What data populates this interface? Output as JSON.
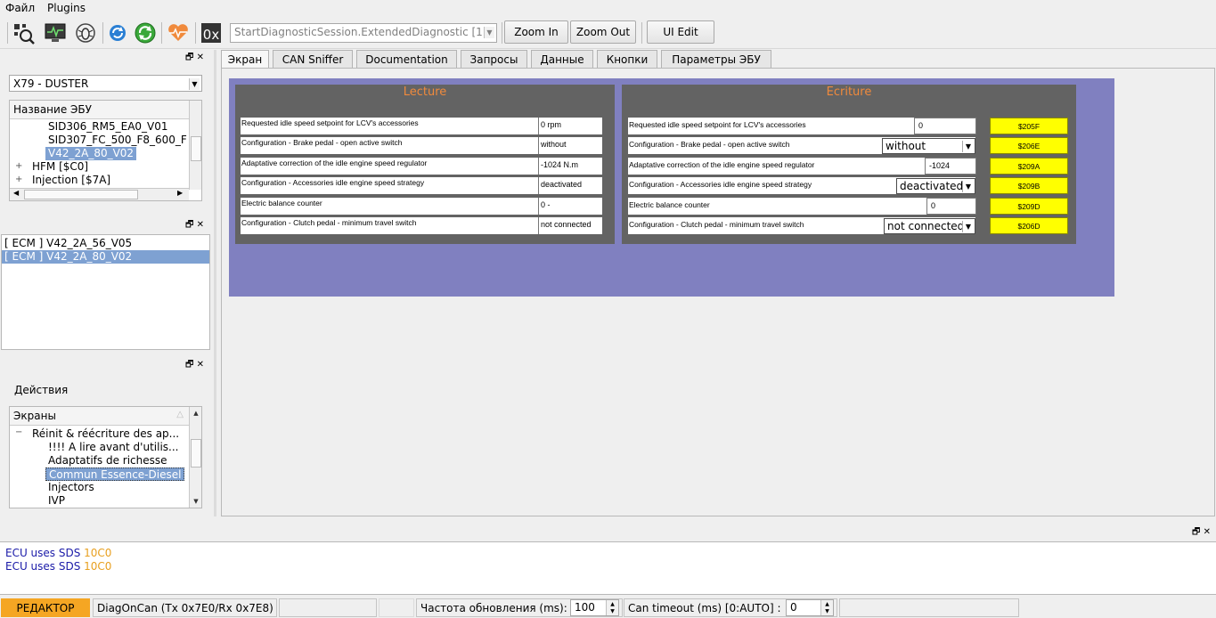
{
  "menubar": {
    "items": [
      "Файл",
      "Plugins"
    ]
  },
  "toolbar": {
    "icons": [
      "scan-icon",
      "monitor-icon",
      "bug-icon",
      "refresh-icon",
      "sync-icon",
      "heart-rate-icon"
    ],
    "hex_label": "0x",
    "session_combo": "StartDiagnosticSession.ExtendedDiagnostic [1",
    "zoom_in": "Zoom In",
    "zoom_out": "Zoom Out",
    "ui_edit": "UI Edit"
  },
  "ecu_panel": {
    "vehicle_combo": "X79 - DUSTER",
    "tree_header": "Название ЭБУ",
    "tree_items": [
      {
        "label": "SID306_RM5_EA0_V01",
        "indent": 2,
        "expand": "",
        "selected": false
      },
      {
        "label": "SID307_FC_500_F8_600_F",
        "indent": 2,
        "expand": "",
        "selected": false
      },
      {
        "label": "V42_2A_80_V02",
        "indent": 2,
        "expand": "",
        "selected": true
      },
      {
        "label": "HFM [$C0]",
        "indent": 1,
        "expand": "+",
        "selected": false
      },
      {
        "label": "Injection [$7A]",
        "indent": 1,
        "expand": "+",
        "selected": false
      }
    ]
  },
  "ecu_list": {
    "items": [
      {
        "label": "[ ECM ] V42_2A_56_V05",
        "selected": false
      },
      {
        "label": "[ ECM ] V42_2A_80_V02",
        "selected": true
      }
    ]
  },
  "actions": {
    "title": "Действия",
    "tree_header": "Экраны",
    "tree_items": [
      {
        "label": "Réinit & réécriture des ap...",
        "indent": 1,
        "expand": "−",
        "selected": false
      },
      {
        "label": "!!!! A lire avant d'utilis...",
        "indent": 2,
        "expand": "",
        "selected": false
      },
      {
        "label": "Adaptatifs de richesse",
        "indent": 2,
        "expand": "",
        "selected": false
      },
      {
        "label": "Commun Essence-Diesel",
        "indent": 2,
        "expand": "",
        "selected": true
      },
      {
        "label": "Injectors",
        "indent": 2,
        "expand": "",
        "selected": false
      },
      {
        "label": "IVP",
        "indent": 2,
        "expand": "",
        "selected": false
      }
    ]
  },
  "tabs": [
    "Экран",
    "CAN Sniffer",
    "Documentation",
    "Запросы",
    "Данные",
    "Кнопки",
    "Параметры ЭБУ"
  ],
  "screen": {
    "lecture": {
      "title": "Lecture",
      "rows": [
        {
          "label": "Requested idle speed setpoint for LCV's accessories",
          "value": "0 rpm"
        },
        {
          "label": "Configuration - Brake pedal - open active switch",
          "value": "without"
        },
        {
          "label": "Adaptative correction of the idle engine speed regulator",
          "value": "-1024 N.m"
        },
        {
          "label": "Configuration - Accessories idle engine speed strategy",
          "value": "deactivated"
        },
        {
          "label": "Electric balance counter",
          "value": "0 -"
        },
        {
          "label": "Configuration - Clutch pedal - minimum travel switch",
          "value": "not connected"
        }
      ]
    },
    "ecriture": {
      "title": "Ecriture",
      "rows": [
        {
          "label": "Requested idle speed setpoint for LCV's accessories",
          "value": "0",
          "kind": "input",
          "button": "$205F"
        },
        {
          "label": "Configuration - Brake pedal - open active switch",
          "value": "without",
          "kind": "combo",
          "button": "$206E"
        },
        {
          "label": "Adaptative correction of the idle engine speed regulator",
          "value": "-1024",
          "kind": "input",
          "button": "$209A"
        },
        {
          "label": "Configuration - Accessories idle engine speed strategy",
          "value": "deactivated",
          "kind": "combo",
          "button": "$209B"
        },
        {
          "label": "Electric balance counter",
          "value": "0",
          "kind": "input",
          "button": "$209D"
        },
        {
          "label": "Configuration - Clutch pedal - minimum travel switch",
          "value": "not connected",
          "kind": "combo",
          "button": "$206D"
        }
      ]
    }
  },
  "log": {
    "lines": [
      {
        "text": "ECU uses SDS ",
        "code": "10C0"
      },
      {
        "text": "ECU uses SDS ",
        "code": "10C0"
      }
    ]
  },
  "statusbar": {
    "mode": "РЕДАКТОР",
    "protocol": "DiagOnCan (Tx 0x7E0/Rx 0x7E8)",
    "refresh_label": "Частота обновления (ms):",
    "refresh_value": "100",
    "timeout_label": "Can timeout (ms) [0:AUTO] :",
    "timeout_value": "0"
  },
  "colors": {
    "accent_orange": "#f08a3c",
    "screen_bg": "#8080c0",
    "frame_bg": "#636363",
    "write_button": "#ffff00",
    "mode_badge": "#f5a623",
    "selection": "#7ea1d2"
  }
}
